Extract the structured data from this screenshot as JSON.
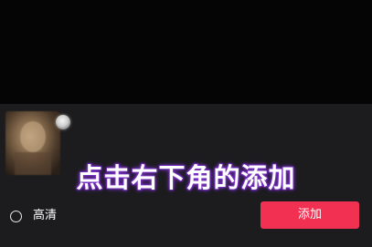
{
  "overlay": {
    "caption": "点击右下角的添加"
  },
  "footer": {
    "hd_option_label": "高清",
    "hd_selected": false,
    "add_button_label": "添加"
  },
  "colors": {
    "accent": "#f23052",
    "caption_glow": "#7d35c6",
    "panel_bg": "#1c1c1e",
    "top_bg": "#050505"
  },
  "icons": {
    "selection_badge": "selection-badge-icon",
    "radio": "radio-unchecked-icon"
  }
}
